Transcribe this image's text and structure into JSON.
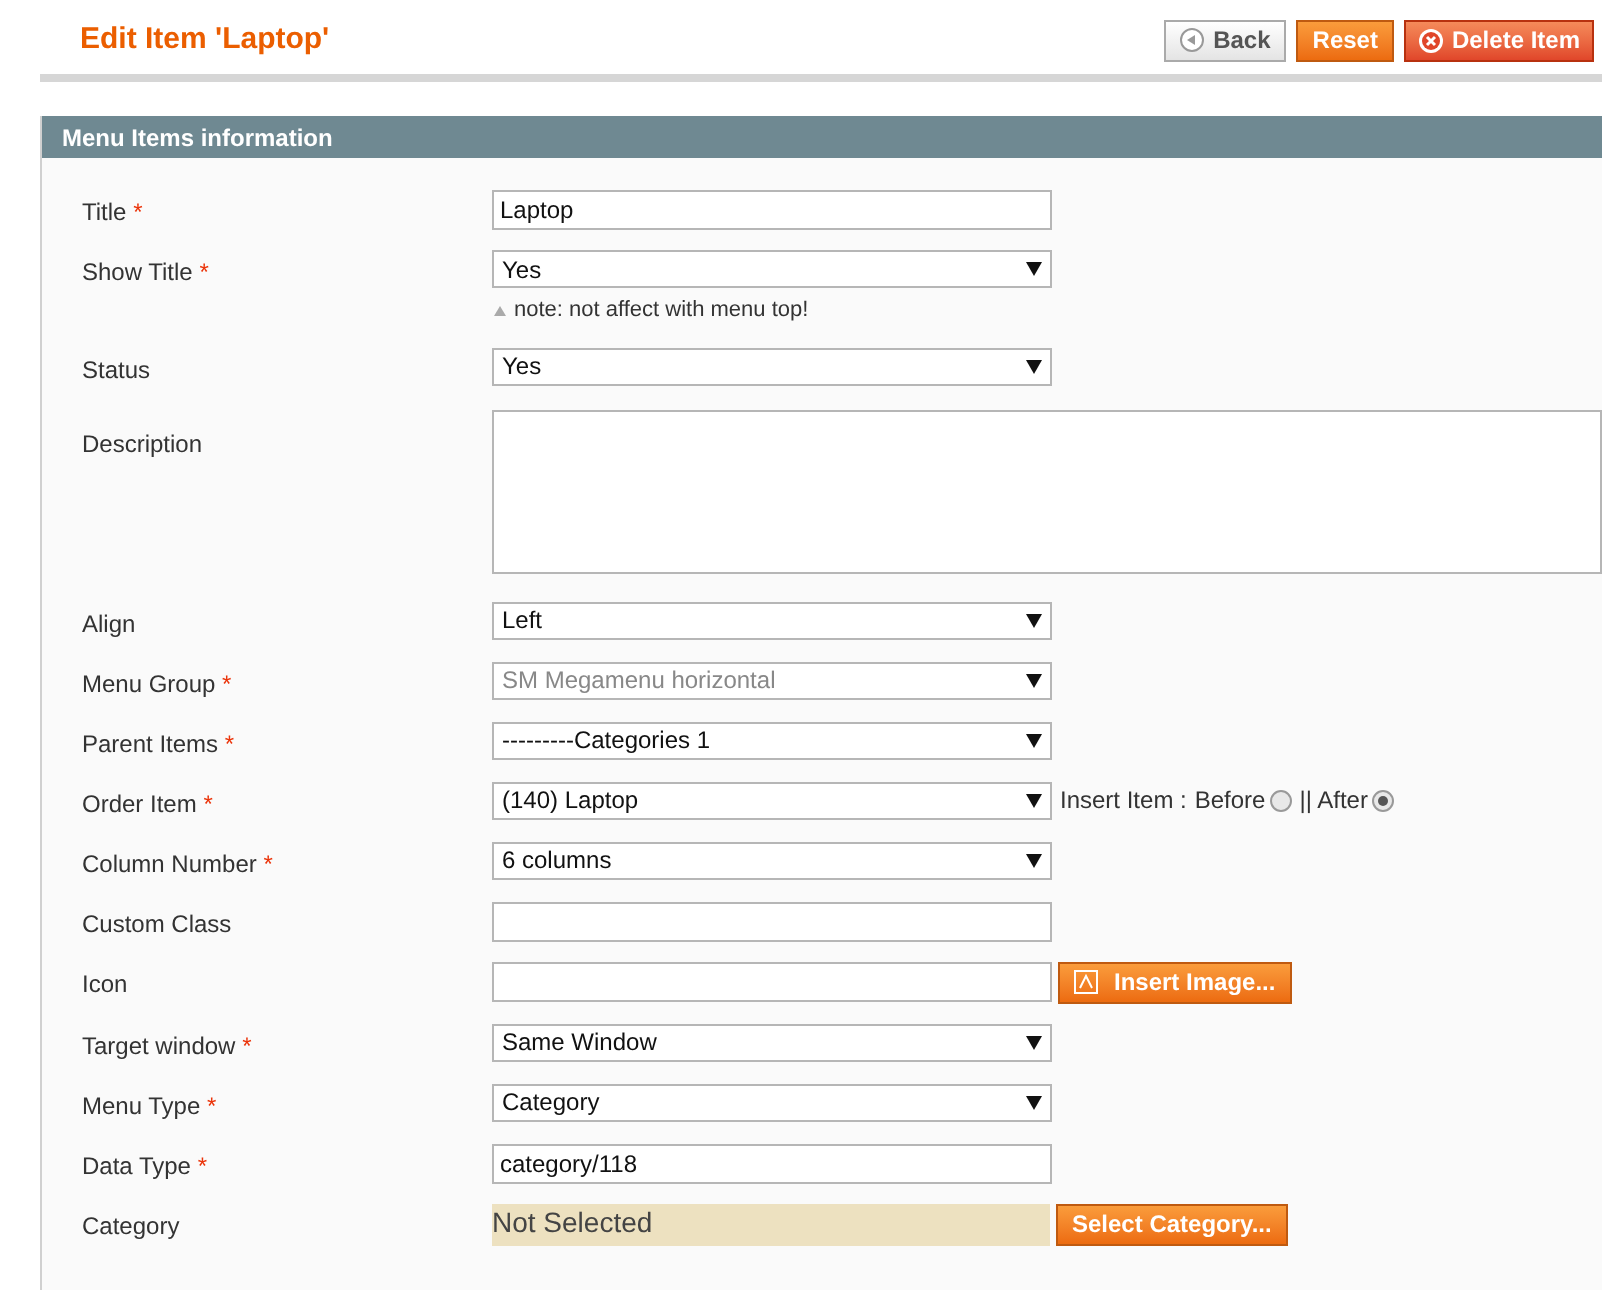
{
  "page_title": "Edit Item 'Laptop'",
  "actions": [
    {
      "label": "Back",
      "kind": "back"
    },
    {
      "label": "Reset",
      "kind": "primary"
    },
    {
      "label": "Delete Item",
      "kind": "delete"
    }
  ],
  "section": {
    "title": "Menu Items information"
  },
  "fields": [
    {
      "label": "Title",
      "required_mark": "*",
      "kind": "text",
      "value": "Laptop"
    },
    {
      "label": "Show Title",
      "required_mark": "*",
      "kind": "select",
      "value": "Yes",
      "disabled": false,
      "note": "note: not affect with menu top!"
    },
    {
      "label": "Status",
      "kind": "select",
      "value": "Yes",
      "disabled": false
    },
    {
      "label": "Description",
      "kind": "textarea"
    },
    {
      "label": "Align",
      "kind": "select",
      "value": "Left",
      "disabled": false
    },
    {
      "label": "Menu Group",
      "required_mark": "*",
      "kind": "select",
      "value": "SM Megamenu horizontal",
      "disabled": true
    },
    {
      "label": "Parent Items",
      "required_mark": "*",
      "kind": "select",
      "value": "---------Categories 1",
      "disabled": false
    },
    {
      "label": "Order Item",
      "required_mark": "*",
      "kind": "order",
      "value": "(140) Laptop",
      "disabled": false,
      "insert_label": "Insert Item : ",
      "options": [
        {
          "label": "Before",
          "selected": false
        },
        {
          "label": "|| After",
          "selected": true
        }
      ]
    },
    {
      "label": "Column Number",
      "required_mark": "*",
      "kind": "select",
      "value": "6 columns",
      "disabled": false
    },
    {
      "label": "Custom Class",
      "kind": "text"
    },
    {
      "label": "Icon",
      "kind": "image",
      "button": "Insert Image..."
    },
    {
      "label": "Target window",
      "required_mark": "*",
      "kind": "select",
      "value": "Same Window",
      "disabled": false
    },
    {
      "label": "Menu Type",
      "required_mark": "*",
      "kind": "select",
      "value": "Category",
      "disabled": false
    },
    {
      "label": "Data Type",
      "required_mark": "*",
      "kind": "text",
      "value": "category/118"
    },
    {
      "label": "Category",
      "kind": "category",
      "value": "Not Selected",
      "button": "Select Category..."
    }
  ]
}
